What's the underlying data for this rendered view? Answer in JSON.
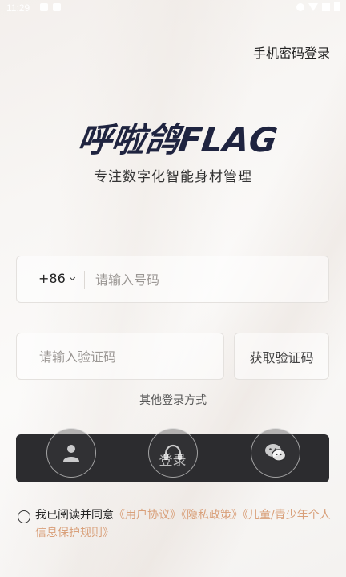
{
  "status_bar": {
    "time": "11:29"
  },
  "header": {
    "password_login_link": "手机密码登录"
  },
  "brand": {
    "logo_text": "呼啦鸽FLAG",
    "slogan": "专注数字化智能身材管理"
  },
  "phone_field": {
    "country_code": "+86",
    "placeholder": "请输入号码",
    "value": ""
  },
  "code_field": {
    "placeholder": "请输入验证码",
    "value": "",
    "get_code_label": "获取验证码"
  },
  "other_login": {
    "label": "其他登录方式",
    "options": [
      {
        "icon": "user-icon"
      },
      {
        "icon": "headset-icon"
      },
      {
        "icon": "wechat-icon"
      }
    ]
  },
  "login_button": {
    "label": "登录"
  },
  "agreement": {
    "prefix": "我已阅读并同意",
    "user_agreement": "《用户协议》",
    "privacy_policy": "《隐私政策》",
    "children_policy": "《儿童/青少年个人信息保护规则》"
  },
  "colors": {
    "link": "#d9a07a",
    "button": "#2c2c2f",
    "logo": "#1f2440"
  }
}
